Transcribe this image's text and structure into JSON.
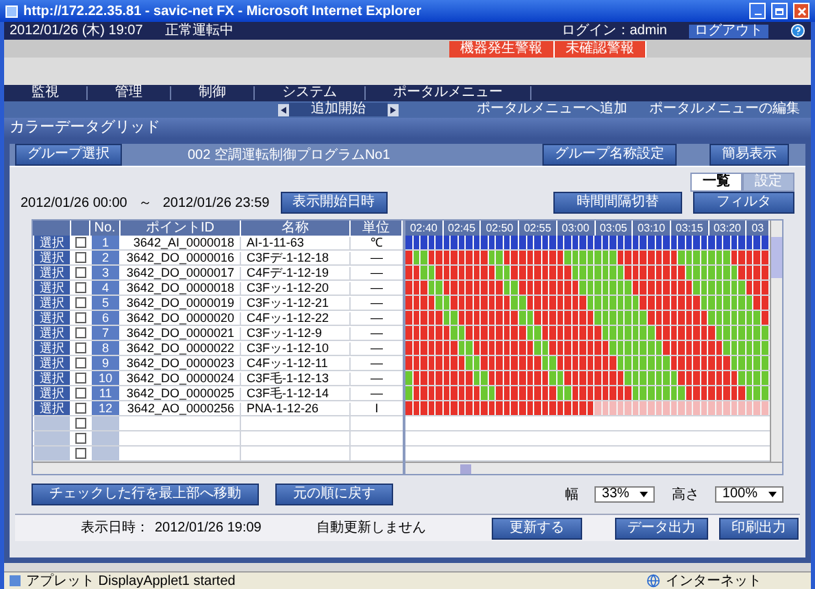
{
  "window": {
    "title": "http://172.22.35.81 - savic-net FX - Microsoft Internet Explorer"
  },
  "info_bar": {
    "datetime": "2012/01/26 (木) 19:07",
    "status": "正常運転中",
    "login": "ログイン：admin",
    "logout": "ログアウト"
  },
  "alarm_tabs": [
    {
      "label": "機器発生警報"
    },
    {
      "label": "未確認警報"
    }
  ],
  "nav": [
    "監視",
    "管理",
    "制御",
    "システム",
    "ポータルメニュー"
  ],
  "sub_nav": {
    "pager": "追加開始",
    "links": [
      "ポータルメニューへ追加",
      "ポータルメニューの編集"
    ]
  },
  "page_title": "カラーデータグリッド",
  "group_bar": {
    "select_button": "グループ選択",
    "group": "002 空調運転制御プログラムNo1",
    "buttons": [
      "グループ名称設定",
      "簡易表示"
    ]
  },
  "view_tabs": [
    {
      "label": "一覧",
      "selected": true
    },
    {
      "label": "設定",
      "selected": false
    }
  ],
  "range": {
    "start": "2012/01/26 00:00",
    "separator": "～",
    "end": "2012/01/26 23:59",
    "button": "表示開始日時",
    "right_buttons": [
      "時間間隔切替",
      "フィルタ"
    ]
  },
  "table": {
    "columns": [
      "No.",
      "ポイントID",
      "名称",
      "単位"
    ],
    "rows": [
      {
        "kind": "point",
        "select": "選択",
        "checked": false,
        "no": "1",
        "point_id": "3642_AI_0000018",
        "name": "AI-1-11-63",
        "unit": "℃",
        "cells": [
          {
            "color": "#2a44c8"
          },
          {
            "color": "#2a44c8"
          },
          {
            "color": "#2a44c8"
          },
          {
            "color": "#2a44c8"
          },
          {
            "color": "#2a44c8"
          },
          {
            "color": "#2a44c8"
          },
          {
            "color": "#2a44c8"
          },
          {
            "color": "#2a44c8"
          },
          {
            "color": "#2a44c8"
          },
          {
            "color": "#2a44c8"
          },
          {
            "color": "#2a44c8"
          },
          {
            "color": "#2a44c8"
          },
          {
            "color": "#2a44c8"
          },
          {
            "color": "#2a44c8"
          },
          {
            "color": "#2a44c8"
          },
          {
            "color": "#2a44c8"
          },
          {
            "color": "#2a44c8"
          },
          {
            "color": "#2a44c8"
          },
          {
            "color": "#2a44c8"
          },
          {
            "color": "#2a44c8"
          },
          {
            "color": "#2a44c8"
          },
          {
            "color": "#2a44c8"
          },
          {
            "color": "#2a44c8"
          },
          {
            "color": "#2a44c8"
          },
          {
            "color": "#2a44c8"
          },
          {
            "color": "#2a44c8"
          },
          {
            "color": "#2a44c8"
          },
          {
            "color": "#2a44c8"
          },
          {
            "color": "#2a44c8"
          },
          {
            "color": "#2a44c8"
          },
          {
            "color": "#2a44c8"
          },
          {
            "color": "#2a44c8"
          },
          {
            "color": "#2a44c8"
          },
          {
            "color": "#2a44c8"
          },
          {
            "color": "#2a44c8"
          },
          {
            "color": "#2a44c8"
          },
          {
            "color": "#2a44c8"
          },
          {
            "color": "#2a44c8"
          },
          {
            "color": "#2a44c8"
          },
          {
            "color": "#2a44c8"
          },
          {
            "color": "#2a44c8"
          },
          {
            "color": "#2a44c8"
          },
          {
            "color": "#2a44c8"
          },
          {
            "color": "#2a44c8"
          },
          {
            "color": "#2a44c8"
          },
          {
            "color": "#2a44c8"
          },
          {
            "color": "#2a44c8"
          },
          {
            "color": "#2a44c8"
          }
        ]
      },
      {
        "kind": "point",
        "select": "選択",
        "checked": false,
        "no": "2",
        "point_id": "3642_DO_0000016",
        "name": "C3Fデ-1-12-18",
        "unit": "—",
        "cells": [
          {
            "color": "#e8322a"
          },
          {
            "color": "#6cc832"
          },
          {
            "color": "#6cc832"
          },
          {
            "color": "#e8322a"
          },
          {
            "color": "#e8322a"
          },
          {
            "color": "#e8322a"
          },
          {
            "color": "#e8322a"
          },
          {
            "color": "#e8322a"
          },
          {
            "color": "#e8322a"
          },
          {
            "color": "#e8322a"
          },
          {
            "color": "#e8322a"
          },
          {
            "color": "#6cc832"
          },
          {
            "color": "#6cc832"
          },
          {
            "color": "#e8322a"
          },
          {
            "color": "#e8322a"
          },
          {
            "color": "#e8322a"
          },
          {
            "color": "#e8322a"
          },
          {
            "color": "#e8322a"
          },
          {
            "color": "#e8322a"
          },
          {
            "color": "#e8322a"
          },
          {
            "color": "#e8322a"
          },
          {
            "color": "#6cc832"
          },
          {
            "color": "#6cc832"
          },
          {
            "color": "#6cc832"
          },
          {
            "color": "#6cc832"
          },
          {
            "color": "#6cc832"
          },
          {
            "color": "#6cc832"
          },
          {
            "color": "#6cc832"
          },
          {
            "color": "#e8322a"
          },
          {
            "color": "#e8322a"
          },
          {
            "color": "#e8322a"
          },
          {
            "color": "#e8322a"
          },
          {
            "color": "#e8322a"
          },
          {
            "color": "#e8322a"
          },
          {
            "color": "#e8322a"
          },
          {
            "color": "#e8322a"
          },
          {
            "color": "#6cc832"
          },
          {
            "color": "#6cc832"
          },
          {
            "color": "#6cc832"
          },
          {
            "color": "#6cc832"
          },
          {
            "color": "#6cc832"
          },
          {
            "color": "#6cc832"
          },
          {
            "color": "#6cc832"
          },
          {
            "color": "#e8322a"
          },
          {
            "color": "#e8322a"
          },
          {
            "color": "#e8322a"
          },
          {
            "color": "#e8322a"
          },
          {
            "color": "#e8322a"
          }
        ]
      },
      {
        "kind": "point",
        "select": "選択",
        "checked": false,
        "no": "3",
        "point_id": "3642_DO_0000017",
        "name": "C4Fデ-1-12-19",
        "unit": "—",
        "cells": [
          {
            "color": "#e8322a"
          },
          {
            "color": "#e8322a"
          },
          {
            "color": "#6cc832"
          },
          {
            "color": "#6cc832"
          },
          {
            "color": "#e8322a"
          },
          {
            "color": "#e8322a"
          },
          {
            "color": "#e8322a"
          },
          {
            "color": "#e8322a"
          },
          {
            "color": "#e8322a"
          },
          {
            "color": "#e8322a"
          },
          {
            "color": "#e8322a"
          },
          {
            "color": "#e8322a"
          },
          {
            "color": "#6cc832"
          },
          {
            "color": "#6cc832"
          },
          {
            "color": "#e8322a"
          },
          {
            "color": "#e8322a"
          },
          {
            "color": "#e8322a"
          },
          {
            "color": "#e8322a"
          },
          {
            "color": "#e8322a"
          },
          {
            "color": "#e8322a"
          },
          {
            "color": "#e8322a"
          },
          {
            "color": "#e8322a"
          },
          {
            "color": "#6cc832"
          },
          {
            "color": "#6cc832"
          },
          {
            "color": "#6cc832"
          },
          {
            "color": "#6cc832"
          },
          {
            "color": "#6cc832"
          },
          {
            "color": "#6cc832"
          },
          {
            "color": "#6cc832"
          },
          {
            "color": "#e8322a"
          },
          {
            "color": "#e8322a"
          },
          {
            "color": "#e8322a"
          },
          {
            "color": "#e8322a"
          },
          {
            "color": "#e8322a"
          },
          {
            "color": "#e8322a"
          },
          {
            "color": "#e8322a"
          },
          {
            "color": "#e8322a"
          },
          {
            "color": "#6cc832"
          },
          {
            "color": "#6cc832"
          },
          {
            "color": "#6cc832"
          },
          {
            "color": "#6cc832"
          },
          {
            "color": "#6cc832"
          },
          {
            "color": "#6cc832"
          },
          {
            "color": "#6cc832"
          },
          {
            "color": "#e8322a"
          },
          {
            "color": "#e8322a"
          },
          {
            "color": "#e8322a"
          },
          {
            "color": "#e8322a"
          }
        ]
      },
      {
        "kind": "point",
        "select": "選択",
        "checked": false,
        "no": "4",
        "point_id": "3642_DO_0000018",
        "name": "C3Fッ-1-12-20",
        "unit": "—",
        "cells": [
          {
            "color": "#e8322a"
          },
          {
            "color": "#e8322a"
          },
          {
            "color": "#e8322a"
          },
          {
            "color": "#6cc832"
          },
          {
            "color": "#6cc832"
          },
          {
            "color": "#e8322a"
          },
          {
            "color": "#e8322a"
          },
          {
            "color": "#e8322a"
          },
          {
            "color": "#e8322a"
          },
          {
            "color": "#e8322a"
          },
          {
            "color": "#e8322a"
          },
          {
            "color": "#e8322a"
          },
          {
            "color": "#e8322a"
          },
          {
            "color": "#6cc832"
          },
          {
            "color": "#6cc832"
          },
          {
            "color": "#e8322a"
          },
          {
            "color": "#e8322a"
          },
          {
            "color": "#e8322a"
          },
          {
            "color": "#e8322a"
          },
          {
            "color": "#e8322a"
          },
          {
            "color": "#e8322a"
          },
          {
            "color": "#e8322a"
          },
          {
            "color": "#e8322a"
          },
          {
            "color": "#6cc832"
          },
          {
            "color": "#6cc832"
          },
          {
            "color": "#6cc832"
          },
          {
            "color": "#6cc832"
          },
          {
            "color": "#6cc832"
          },
          {
            "color": "#6cc832"
          },
          {
            "color": "#6cc832"
          },
          {
            "color": "#e8322a"
          },
          {
            "color": "#e8322a"
          },
          {
            "color": "#e8322a"
          },
          {
            "color": "#e8322a"
          },
          {
            "color": "#e8322a"
          },
          {
            "color": "#e8322a"
          },
          {
            "color": "#e8322a"
          },
          {
            "color": "#e8322a"
          },
          {
            "color": "#6cc832"
          },
          {
            "color": "#6cc832"
          },
          {
            "color": "#6cc832"
          },
          {
            "color": "#6cc832"
          },
          {
            "color": "#6cc832"
          },
          {
            "color": "#6cc832"
          },
          {
            "color": "#6cc832"
          },
          {
            "color": "#e8322a"
          },
          {
            "color": "#e8322a"
          },
          {
            "color": "#e8322a"
          }
        ]
      },
      {
        "kind": "point",
        "select": "選択",
        "checked": false,
        "no": "5",
        "point_id": "3642_DO_0000019",
        "name": "C3Fッ-1-12-21",
        "unit": "—",
        "cells": [
          {
            "color": "#e8322a"
          },
          {
            "color": "#e8322a"
          },
          {
            "color": "#e8322a"
          },
          {
            "color": "#e8322a"
          },
          {
            "color": "#6cc832"
          },
          {
            "color": "#6cc832"
          },
          {
            "color": "#e8322a"
          },
          {
            "color": "#e8322a"
          },
          {
            "color": "#e8322a"
          },
          {
            "color": "#e8322a"
          },
          {
            "color": "#e8322a"
          },
          {
            "color": "#e8322a"
          },
          {
            "color": "#e8322a"
          },
          {
            "color": "#e8322a"
          },
          {
            "color": "#6cc832"
          },
          {
            "color": "#6cc832"
          },
          {
            "color": "#e8322a"
          },
          {
            "color": "#e8322a"
          },
          {
            "color": "#e8322a"
          },
          {
            "color": "#e8322a"
          },
          {
            "color": "#e8322a"
          },
          {
            "color": "#e8322a"
          },
          {
            "color": "#e8322a"
          },
          {
            "color": "#e8322a"
          },
          {
            "color": "#6cc832"
          },
          {
            "color": "#6cc832"
          },
          {
            "color": "#6cc832"
          },
          {
            "color": "#6cc832"
          },
          {
            "color": "#6cc832"
          },
          {
            "color": "#6cc832"
          },
          {
            "color": "#6cc832"
          },
          {
            "color": "#e8322a"
          },
          {
            "color": "#e8322a"
          },
          {
            "color": "#e8322a"
          },
          {
            "color": "#e8322a"
          },
          {
            "color": "#e8322a"
          },
          {
            "color": "#e8322a"
          },
          {
            "color": "#e8322a"
          },
          {
            "color": "#e8322a"
          },
          {
            "color": "#6cc832"
          },
          {
            "color": "#6cc832"
          },
          {
            "color": "#6cc832"
          },
          {
            "color": "#6cc832"
          },
          {
            "color": "#6cc832"
          },
          {
            "color": "#6cc832"
          },
          {
            "color": "#6cc832"
          },
          {
            "color": "#e8322a"
          },
          {
            "color": "#e8322a"
          }
        ]
      },
      {
        "kind": "point",
        "select": "選択",
        "checked": false,
        "no": "6",
        "point_id": "3642_DO_0000020",
        "name": "C4Fッ-1-12-22",
        "unit": "—",
        "cells": [
          {
            "color": "#e8322a"
          },
          {
            "color": "#e8322a"
          },
          {
            "color": "#e8322a"
          },
          {
            "color": "#e8322a"
          },
          {
            "color": "#e8322a"
          },
          {
            "color": "#6cc832"
          },
          {
            "color": "#6cc832"
          },
          {
            "color": "#e8322a"
          },
          {
            "color": "#e8322a"
          },
          {
            "color": "#e8322a"
          },
          {
            "color": "#e8322a"
          },
          {
            "color": "#e8322a"
          },
          {
            "color": "#e8322a"
          },
          {
            "color": "#e8322a"
          },
          {
            "color": "#e8322a"
          },
          {
            "color": "#6cc832"
          },
          {
            "color": "#6cc832"
          },
          {
            "color": "#e8322a"
          },
          {
            "color": "#e8322a"
          },
          {
            "color": "#e8322a"
          },
          {
            "color": "#e8322a"
          },
          {
            "color": "#e8322a"
          },
          {
            "color": "#e8322a"
          },
          {
            "color": "#e8322a"
          },
          {
            "color": "#e8322a"
          },
          {
            "color": "#6cc832"
          },
          {
            "color": "#6cc832"
          },
          {
            "color": "#6cc832"
          },
          {
            "color": "#6cc832"
          },
          {
            "color": "#6cc832"
          },
          {
            "color": "#6cc832"
          },
          {
            "color": "#6cc832"
          },
          {
            "color": "#e8322a"
          },
          {
            "color": "#e8322a"
          },
          {
            "color": "#e8322a"
          },
          {
            "color": "#e8322a"
          },
          {
            "color": "#e8322a"
          },
          {
            "color": "#e8322a"
          },
          {
            "color": "#e8322a"
          },
          {
            "color": "#e8322a"
          },
          {
            "color": "#6cc832"
          },
          {
            "color": "#6cc832"
          },
          {
            "color": "#6cc832"
          },
          {
            "color": "#6cc832"
          },
          {
            "color": "#6cc832"
          },
          {
            "color": "#6cc832"
          },
          {
            "color": "#6cc832"
          },
          {
            "color": "#e8322a"
          }
        ]
      },
      {
        "kind": "point",
        "select": "選択",
        "checked": false,
        "no": "7",
        "point_id": "3642_DO_0000021",
        "name": "C3Fッ-1-12-9",
        "unit": "—",
        "cells": [
          {
            "color": "#e8322a"
          },
          {
            "color": "#e8322a"
          },
          {
            "color": "#e8322a"
          },
          {
            "color": "#e8322a"
          },
          {
            "color": "#e8322a"
          },
          {
            "color": "#e8322a"
          },
          {
            "color": "#6cc832"
          },
          {
            "color": "#6cc832"
          },
          {
            "color": "#e8322a"
          },
          {
            "color": "#e8322a"
          },
          {
            "color": "#e8322a"
          },
          {
            "color": "#e8322a"
          },
          {
            "color": "#e8322a"
          },
          {
            "color": "#e8322a"
          },
          {
            "color": "#e8322a"
          },
          {
            "color": "#e8322a"
          },
          {
            "color": "#6cc832"
          },
          {
            "color": "#6cc832"
          },
          {
            "color": "#e8322a"
          },
          {
            "color": "#e8322a"
          },
          {
            "color": "#e8322a"
          },
          {
            "color": "#e8322a"
          },
          {
            "color": "#e8322a"
          },
          {
            "color": "#e8322a"
          },
          {
            "color": "#e8322a"
          },
          {
            "color": "#e8322a"
          },
          {
            "color": "#6cc832"
          },
          {
            "color": "#6cc832"
          },
          {
            "color": "#6cc832"
          },
          {
            "color": "#6cc832"
          },
          {
            "color": "#6cc832"
          },
          {
            "color": "#6cc832"
          },
          {
            "color": "#6cc832"
          },
          {
            "color": "#e8322a"
          },
          {
            "color": "#e8322a"
          },
          {
            "color": "#e8322a"
          },
          {
            "color": "#e8322a"
          },
          {
            "color": "#e8322a"
          },
          {
            "color": "#e8322a"
          },
          {
            "color": "#e8322a"
          },
          {
            "color": "#e8322a"
          },
          {
            "color": "#6cc832"
          },
          {
            "color": "#6cc832"
          },
          {
            "color": "#6cc832"
          },
          {
            "color": "#6cc832"
          },
          {
            "color": "#6cc832"
          },
          {
            "color": "#6cc832"
          },
          {
            "color": "#6cc832"
          }
        ]
      },
      {
        "kind": "point",
        "select": "選択",
        "checked": false,
        "no": "8",
        "point_id": "3642_DO_0000022",
        "name": "C3Fッ-1-12-10",
        "unit": "—",
        "cells": [
          {
            "color": "#e8322a"
          },
          {
            "color": "#e8322a"
          },
          {
            "color": "#e8322a"
          },
          {
            "color": "#e8322a"
          },
          {
            "color": "#e8322a"
          },
          {
            "color": "#e8322a"
          },
          {
            "color": "#e8322a"
          },
          {
            "color": "#6cc832"
          },
          {
            "color": "#6cc832"
          },
          {
            "color": "#e8322a"
          },
          {
            "color": "#e8322a"
          },
          {
            "color": "#e8322a"
          },
          {
            "color": "#e8322a"
          },
          {
            "color": "#e8322a"
          },
          {
            "color": "#e8322a"
          },
          {
            "color": "#e8322a"
          },
          {
            "color": "#e8322a"
          },
          {
            "color": "#6cc832"
          },
          {
            "color": "#6cc832"
          },
          {
            "color": "#e8322a"
          },
          {
            "color": "#e8322a"
          },
          {
            "color": "#e8322a"
          },
          {
            "color": "#e8322a"
          },
          {
            "color": "#e8322a"
          },
          {
            "color": "#e8322a"
          },
          {
            "color": "#e8322a"
          },
          {
            "color": "#e8322a"
          },
          {
            "color": "#6cc832"
          },
          {
            "color": "#6cc832"
          },
          {
            "color": "#6cc832"
          },
          {
            "color": "#6cc832"
          },
          {
            "color": "#6cc832"
          },
          {
            "color": "#6cc832"
          },
          {
            "color": "#6cc832"
          },
          {
            "color": "#e8322a"
          },
          {
            "color": "#e8322a"
          },
          {
            "color": "#e8322a"
          },
          {
            "color": "#e8322a"
          },
          {
            "color": "#e8322a"
          },
          {
            "color": "#e8322a"
          },
          {
            "color": "#e8322a"
          },
          {
            "color": "#e8322a"
          },
          {
            "color": "#6cc832"
          },
          {
            "color": "#6cc832"
          },
          {
            "color": "#6cc832"
          },
          {
            "color": "#6cc832"
          },
          {
            "color": "#6cc832"
          },
          {
            "color": "#6cc832"
          }
        ]
      },
      {
        "kind": "point",
        "select": "選択",
        "checked": false,
        "no": "9",
        "point_id": "3642_DO_0000023",
        "name": "C4Fッ-1-12-11",
        "unit": "—",
        "cells": [
          {
            "color": "#e8322a"
          },
          {
            "color": "#e8322a"
          },
          {
            "color": "#e8322a"
          },
          {
            "color": "#e8322a"
          },
          {
            "color": "#e8322a"
          },
          {
            "color": "#e8322a"
          },
          {
            "color": "#e8322a"
          },
          {
            "color": "#e8322a"
          },
          {
            "color": "#6cc832"
          },
          {
            "color": "#6cc832"
          },
          {
            "color": "#e8322a"
          },
          {
            "color": "#e8322a"
          },
          {
            "color": "#e8322a"
          },
          {
            "color": "#e8322a"
          },
          {
            "color": "#e8322a"
          },
          {
            "color": "#e8322a"
          },
          {
            "color": "#e8322a"
          },
          {
            "color": "#e8322a"
          },
          {
            "color": "#6cc832"
          },
          {
            "color": "#6cc832"
          },
          {
            "color": "#e8322a"
          },
          {
            "color": "#e8322a"
          },
          {
            "color": "#e8322a"
          },
          {
            "color": "#e8322a"
          },
          {
            "color": "#e8322a"
          },
          {
            "color": "#e8322a"
          },
          {
            "color": "#e8322a"
          },
          {
            "color": "#e8322a"
          },
          {
            "color": "#6cc832"
          },
          {
            "color": "#6cc832"
          },
          {
            "color": "#6cc832"
          },
          {
            "color": "#6cc832"
          },
          {
            "color": "#6cc832"
          },
          {
            "color": "#6cc832"
          },
          {
            "color": "#6cc832"
          },
          {
            "color": "#e8322a"
          },
          {
            "color": "#e8322a"
          },
          {
            "color": "#e8322a"
          },
          {
            "color": "#e8322a"
          },
          {
            "color": "#e8322a"
          },
          {
            "color": "#e8322a"
          },
          {
            "color": "#e8322a"
          },
          {
            "color": "#e8322a"
          },
          {
            "color": "#6cc832"
          },
          {
            "color": "#6cc832"
          },
          {
            "color": "#6cc832"
          },
          {
            "color": "#6cc832"
          },
          {
            "color": "#6cc832"
          }
        ]
      },
      {
        "kind": "point",
        "select": "選択",
        "checked": false,
        "no": "10",
        "point_id": "3642_DO_0000024",
        "name": "C3F毛-1-12-13",
        "unit": "—",
        "cells": [
          {
            "color": "#6cc832"
          },
          {
            "color": "#e8322a"
          },
          {
            "color": "#e8322a"
          },
          {
            "color": "#e8322a"
          },
          {
            "color": "#e8322a"
          },
          {
            "color": "#e8322a"
          },
          {
            "color": "#e8322a"
          },
          {
            "color": "#e8322a"
          },
          {
            "color": "#e8322a"
          },
          {
            "color": "#6cc832"
          },
          {
            "color": "#6cc832"
          },
          {
            "color": "#e8322a"
          },
          {
            "color": "#e8322a"
          },
          {
            "color": "#e8322a"
          },
          {
            "color": "#e8322a"
          },
          {
            "color": "#e8322a"
          },
          {
            "color": "#e8322a"
          },
          {
            "color": "#e8322a"
          },
          {
            "color": "#e8322a"
          },
          {
            "color": "#6cc832"
          },
          {
            "color": "#6cc832"
          },
          {
            "color": "#e8322a"
          },
          {
            "color": "#e8322a"
          },
          {
            "color": "#e8322a"
          },
          {
            "color": "#e8322a"
          },
          {
            "color": "#e8322a"
          },
          {
            "color": "#e8322a"
          },
          {
            "color": "#e8322a"
          },
          {
            "color": "#e8322a"
          },
          {
            "color": "#6cc832"
          },
          {
            "color": "#6cc832"
          },
          {
            "color": "#6cc832"
          },
          {
            "color": "#6cc832"
          },
          {
            "color": "#6cc832"
          },
          {
            "color": "#6cc832"
          },
          {
            "color": "#6cc832"
          },
          {
            "color": "#e8322a"
          },
          {
            "color": "#e8322a"
          },
          {
            "color": "#e8322a"
          },
          {
            "color": "#e8322a"
          },
          {
            "color": "#e8322a"
          },
          {
            "color": "#e8322a"
          },
          {
            "color": "#e8322a"
          },
          {
            "color": "#e8322a"
          },
          {
            "color": "#6cc832"
          },
          {
            "color": "#6cc832"
          },
          {
            "color": "#6cc832"
          },
          {
            "color": "#6cc832"
          }
        ]
      },
      {
        "kind": "point",
        "select": "選択",
        "checked": false,
        "no": "11",
        "point_id": "3642_DO_0000025",
        "name": "C3F毛-1-12-14",
        "unit": "—",
        "cells": [
          {
            "color": "#6cc832"
          },
          {
            "color": "#e8322a"
          },
          {
            "color": "#e8322a"
          },
          {
            "color": "#e8322a"
          },
          {
            "color": "#e8322a"
          },
          {
            "color": "#e8322a"
          },
          {
            "color": "#e8322a"
          },
          {
            "color": "#e8322a"
          },
          {
            "color": "#e8322a"
          },
          {
            "color": "#e8322a"
          },
          {
            "color": "#6cc832"
          },
          {
            "color": "#6cc832"
          },
          {
            "color": "#e8322a"
          },
          {
            "color": "#e8322a"
          },
          {
            "color": "#e8322a"
          },
          {
            "color": "#e8322a"
          },
          {
            "color": "#e8322a"
          },
          {
            "color": "#e8322a"
          },
          {
            "color": "#e8322a"
          },
          {
            "color": "#e8322a"
          },
          {
            "color": "#6cc832"
          },
          {
            "color": "#6cc832"
          },
          {
            "color": "#e8322a"
          },
          {
            "color": "#e8322a"
          },
          {
            "color": "#e8322a"
          },
          {
            "color": "#e8322a"
          },
          {
            "color": "#e8322a"
          },
          {
            "color": "#e8322a"
          },
          {
            "color": "#e8322a"
          },
          {
            "color": "#e8322a"
          },
          {
            "color": "#6cc832"
          },
          {
            "color": "#6cc832"
          },
          {
            "color": "#6cc832"
          },
          {
            "color": "#6cc832"
          },
          {
            "color": "#6cc832"
          },
          {
            "color": "#6cc832"
          },
          {
            "color": "#6cc832"
          },
          {
            "color": "#e8322a"
          },
          {
            "color": "#e8322a"
          },
          {
            "color": "#e8322a"
          },
          {
            "color": "#e8322a"
          },
          {
            "color": "#e8322a"
          },
          {
            "color": "#e8322a"
          },
          {
            "color": "#e8322a"
          },
          {
            "color": "#e8322a"
          },
          {
            "color": "#6cc832"
          },
          {
            "color": "#6cc832"
          },
          {
            "color": "#6cc832"
          }
        ]
      },
      {
        "kind": "point",
        "select": "選択",
        "checked": false,
        "no": "12",
        "point_id": "3642_AO_0000256",
        "name": "PNA-1-12-26",
        "unit": "I",
        "cells": [
          {
            "color": "#e8322a"
          },
          {
            "color": "#e8322a"
          },
          {
            "color": "#e8322a"
          },
          {
            "color": "#e8322a"
          },
          {
            "color": "#e8322a"
          },
          {
            "color": "#e8322a"
          },
          {
            "color": "#e8322a"
          },
          {
            "color": "#e8322a"
          },
          {
            "color": "#e8322a"
          },
          {
            "color": "#e8322a"
          },
          {
            "color": "#e8322a"
          },
          {
            "color": "#e8322a"
          },
          {
            "color": "#e8322a"
          },
          {
            "color": "#e8322a"
          },
          {
            "color": "#e8322a"
          },
          {
            "color": "#e8322a"
          },
          {
            "color": "#e8322a"
          },
          {
            "color": "#e8322a"
          },
          {
            "color": "#e8322a"
          },
          {
            "color": "#e8322a"
          },
          {
            "color": "#e8322a"
          },
          {
            "color": "#e8322a"
          },
          {
            "color": "#e8322a"
          },
          {
            "color": "#e8322a"
          },
          {
            "color": "#e8322a"
          },
          {
            "color": "#f4b8b8"
          },
          {
            "color": "#f4b8b8"
          },
          {
            "color": "#f4b8b8"
          },
          {
            "color": "#f4b8b8"
          },
          {
            "color": "#f4b8b8"
          },
          {
            "color": "#f4b8b8"
          },
          {
            "color": "#f4b8b8"
          },
          {
            "color": "#f4b8b8"
          },
          {
            "color": "#f4b8b8"
          },
          {
            "color": "#f4b8b8"
          },
          {
            "color": "#f4b8b8"
          },
          {
            "color": "#f4b8b8"
          },
          {
            "color": "#f4b8b8"
          },
          {
            "color": "#f4b8b8"
          },
          {
            "color": "#f4b8b8"
          },
          {
            "color": "#f4b8b8"
          },
          {
            "color": "#f4b8b8"
          },
          {
            "color": "#f4b8b8"
          },
          {
            "color": "#f4b8b8"
          },
          {
            "color": "#f4b8b8"
          },
          {
            "color": "#f4b8b8"
          },
          {
            "color": "#f4b8b8"
          },
          {
            "color": "#f4b8b8"
          }
        ]
      },
      {
        "kind": "empty",
        "checked": false
      },
      {
        "kind": "empty",
        "checked": false
      },
      {
        "kind": "empty",
        "checked": false
      }
    ],
    "times": [
      "02:40",
      "02:45",
      "02:50",
      "02:55",
      "03:00",
      "03:05",
      "03:10",
      "03:15",
      "03:20",
      "03"
    ]
  },
  "actions": {
    "left": [
      "チェックした行を最上部へ移動",
      "元の順に戻す"
    ],
    "width_label": "幅",
    "width_value": "33%",
    "height_label": "高さ",
    "height_value": "100%"
  },
  "footer": {
    "label": "表示日時：",
    "datetime": "2012/01/26 19:09",
    "auto": "自動更新しません",
    "refresh": "更新する",
    "buttons": [
      "データ出力",
      "印刷出力"
    ]
  },
  "status_bar": {
    "text": "アプレット DisplayApplet1 started",
    "zone": "インターネット"
  }
}
